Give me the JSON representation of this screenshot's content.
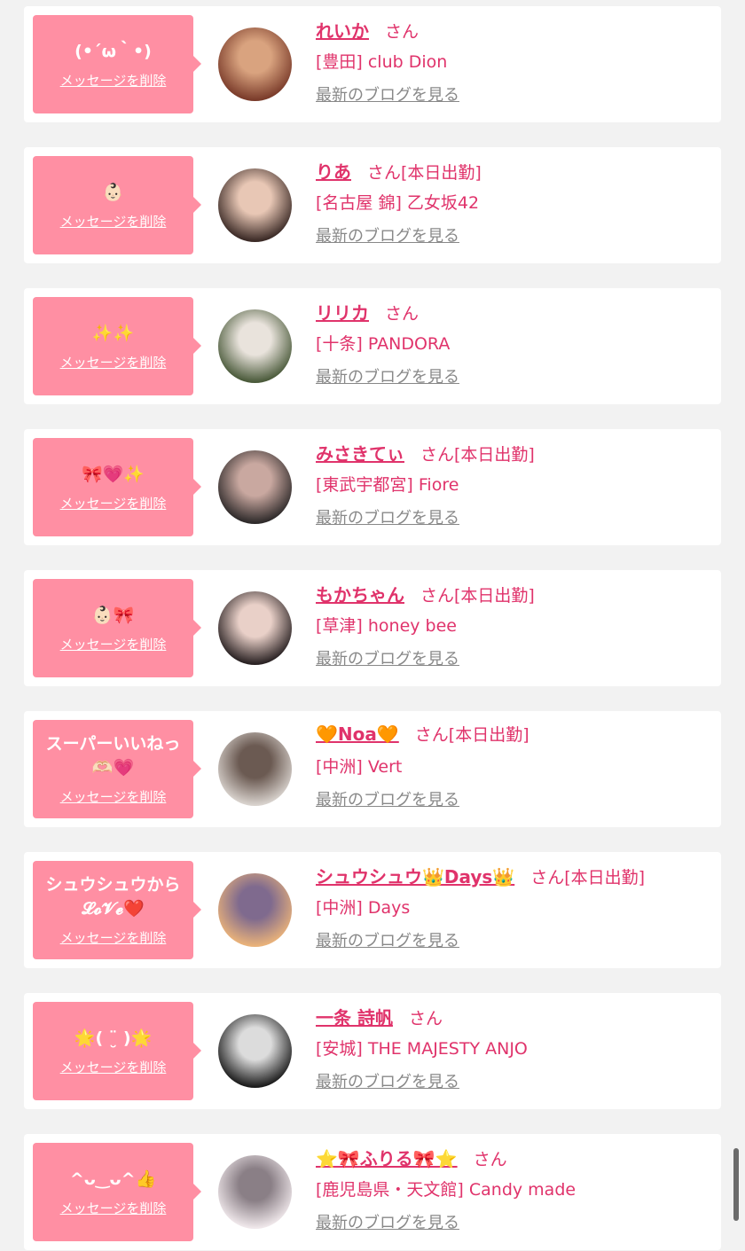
{
  "colors": {
    "accent": "#e0336b",
    "bubble": "#ff8fa3",
    "background": "#f2f2f2"
  },
  "common": {
    "delete_label": "メッセージを削除",
    "san_label": "さん",
    "blog_label": "最新のブログを見る"
  },
  "messages": [
    {
      "text": "(•´ω｀•)",
      "name": "れいか",
      "today": "",
      "shop": "[豊田] club Dion"
    },
    {
      "text": "👶🏻",
      "name": "りあ",
      "today": "[本日出勤]",
      "shop": "[名古屋 錦] 乙女坂42"
    },
    {
      "text": "✨✨",
      "name": "リリカ",
      "today": "",
      "shop": "[十条] PANDORA"
    },
    {
      "text": "🎀💗✨",
      "name": "みさきてぃ",
      "today": "[本日出勤]",
      "shop": "[東武宇都宮] Fiore"
    },
    {
      "text": "👶🏻🎀",
      "name": "もかちゃん",
      "today": "[本日出勤]",
      "shop": "[草津] honey bee"
    },
    {
      "text": "スーパーいいねっ\n🫶🏻💗",
      "name": "🧡Noa🧡",
      "today": "[本日出勤]",
      "shop": "[中洲] Vert"
    },
    {
      "text": "シュウシュウから\n𝓛𝓸𝓥𝓮❤️",
      "name": "シュウシュウ👑Days👑",
      "today": "[本日出勤]",
      "shop": "[中洲] Days"
    },
    {
      "text": "🌟( ¨̮ )🌟",
      "name": "一条 詩帆",
      "today": "",
      "shop": "[安城] THE MAJESTY ANJO"
    },
    {
      "text": "^ᴗ‿ᴗ^👍",
      "name": "⭐🎀ふりる🎀⭐",
      "today": "",
      "shop": "[鹿児島県・天文館] Candy made"
    }
  ]
}
